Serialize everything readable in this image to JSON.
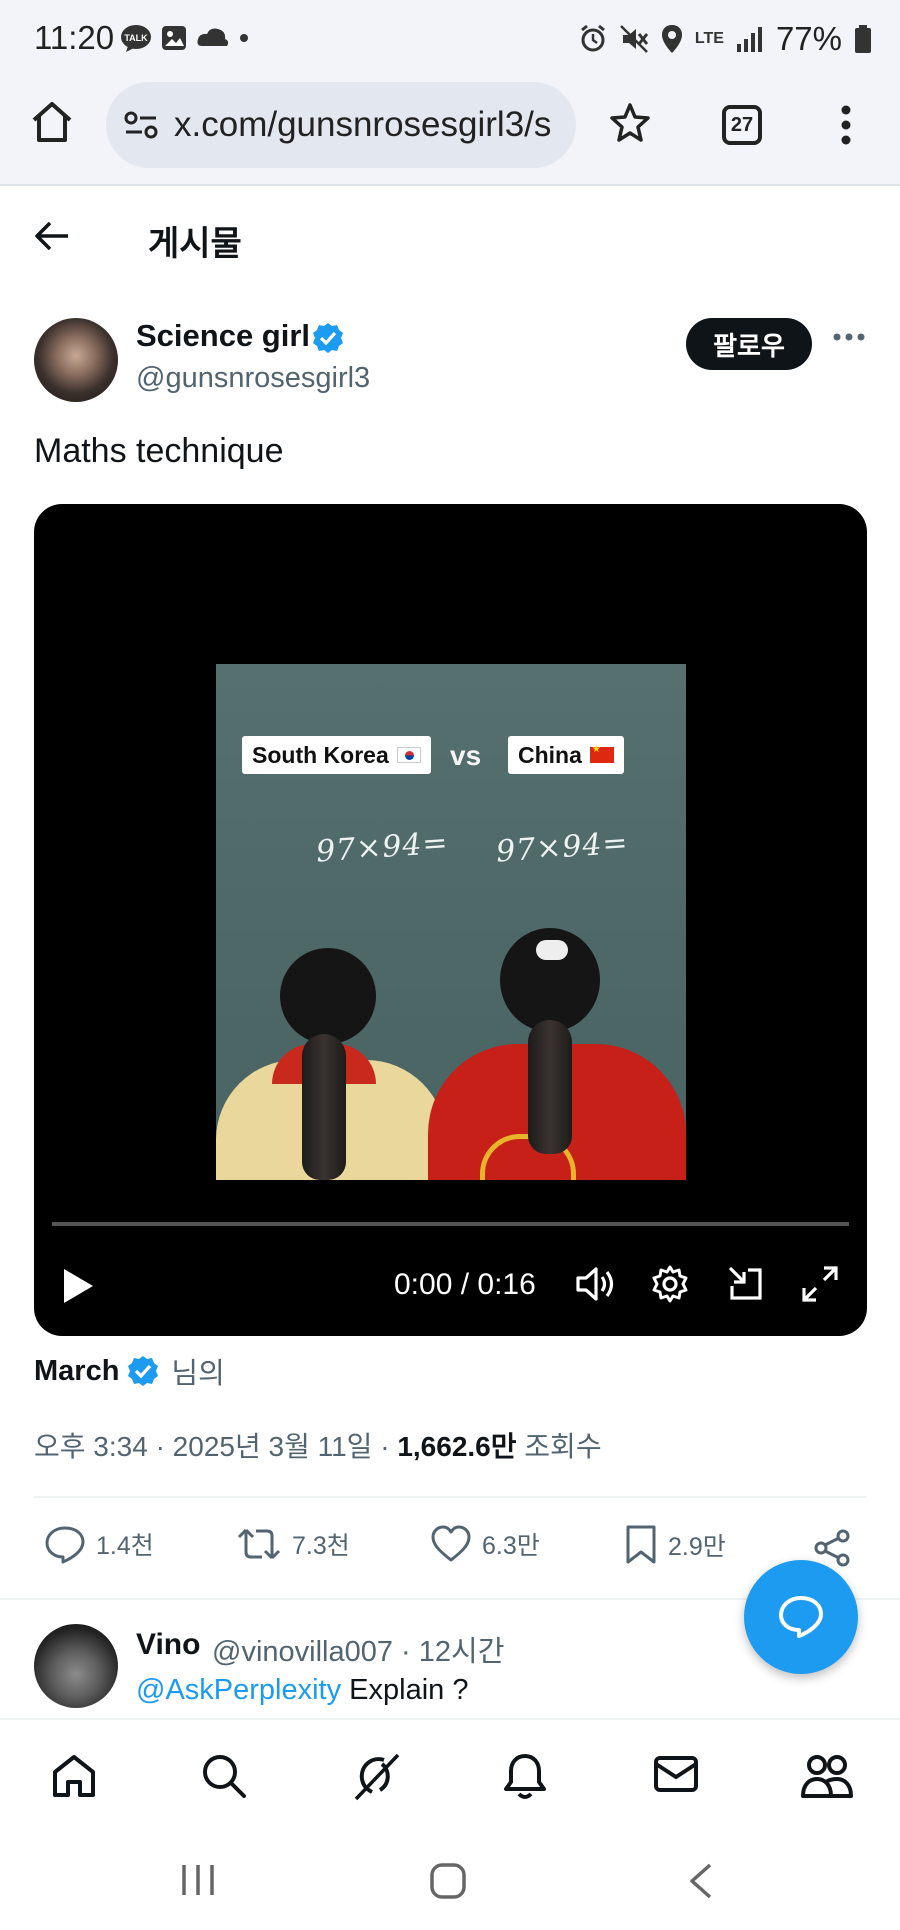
{
  "status_bar": {
    "time": "11:20",
    "notification_icons": [
      "talk-icon",
      "gallery-icon",
      "cloud-icon"
    ],
    "network": "LTE",
    "battery": "77%"
  },
  "browser": {
    "url": "x.com/gunsnrosesgirl3/s",
    "tab_count": "27"
  },
  "page": {
    "title": "게시물"
  },
  "post": {
    "author_name": "Science girl",
    "author_handle": "@gunsnrosesgirl3",
    "follow_label": "팔로우",
    "text": "Maths technique",
    "video": {
      "label_left": "South Korea",
      "vs": "vs",
      "label_right": "China",
      "chalk_left": "97×94=",
      "chalk_right": "97×94=",
      "time": "0:00 / 0:16",
      "progress": 0
    },
    "source_name": "March",
    "source_suffix": "님의",
    "timestamp": "오후 3:34 · 2025년 3월 11일 · ",
    "views_count": "1,662.6만",
    "views_label": " 조회수",
    "stats": {
      "replies": "1.4천",
      "reposts": "7.3천",
      "likes": "6.3만",
      "bookmarks": "2.9만"
    }
  },
  "reply": {
    "name": "Vino",
    "meta": "@vinovilla007 · 12시간",
    "mention": "@AskPerplexity",
    "text": " Explain ?"
  },
  "colors": {
    "accent": "#1d9bf0",
    "text": "#0f1419",
    "muted": "#536471"
  }
}
